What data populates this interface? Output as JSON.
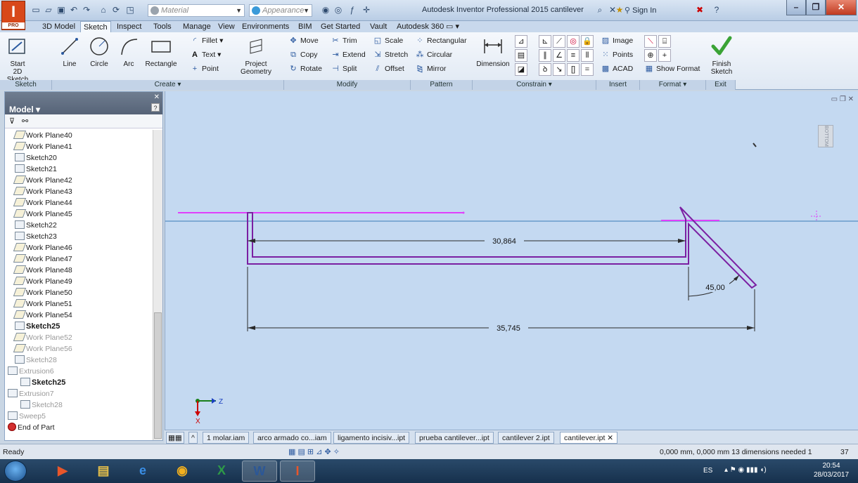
{
  "window": {
    "title": "Autodesk Inventor Professional 2015   cantilever",
    "material_placeholder": "Material",
    "appearance_placeholder": "Appearance",
    "sign_in": "Sign In",
    "app_logo_letter": "I",
    "app_logo_sub": "PRO"
  },
  "ribbon_tabs": [
    "3D Model",
    "Sketch",
    "Inspect",
    "Tools",
    "Manage",
    "View",
    "Environments",
    "BIM",
    "Get Started",
    "Vault",
    "Autodesk 360"
  ],
  "active_tab": "Sketch",
  "ribbon": {
    "sketch_panel": {
      "title": "Sketch",
      "start_2d_sketch": "Start\n2D Sketch"
    },
    "create_panel": {
      "title": "Create ▾",
      "line": "Line",
      "circle": "Circle",
      "arc": "Arc",
      "rectangle": "Rectangle",
      "fillet": "Fillet ▾",
      "text": "Text ▾",
      "point": "Point",
      "project_geometry": "Project\nGeometry"
    },
    "modify_panel": {
      "title": "Modify",
      "move": "Move",
      "copy": "Copy",
      "rotate": "Rotate",
      "trim": "Trim",
      "extend": "Extend",
      "split": "Split",
      "scale": "Scale",
      "stretch": "Stretch",
      "offset": "Offset"
    },
    "pattern_panel": {
      "title": "Pattern",
      "rectangular": "Rectangular",
      "circular": "Circular",
      "mirror": "Mirror"
    },
    "constrain_panel": {
      "title": "Constrain ▾",
      "dimension": "Dimension"
    },
    "insert_panel": {
      "title": "Insert",
      "image": "Image",
      "points": "Points",
      "acad": "ACAD"
    },
    "format_panel": {
      "title": "Format ▾",
      "show_format": "Show Format"
    },
    "exit_panel": {
      "title": "Exit",
      "finish_sketch": "Finish\nSketch"
    }
  },
  "browser": {
    "title": "Model ▾",
    "items": [
      {
        "label": "Work Plane40",
        "kind": "plane",
        "style": "normal"
      },
      {
        "label": "Work Plane41",
        "kind": "plane",
        "style": "normal"
      },
      {
        "label": "Sketch20",
        "kind": "sketch",
        "style": "normal"
      },
      {
        "label": "Sketch21",
        "kind": "sketch",
        "style": "normal"
      },
      {
        "label": "Work Plane42",
        "kind": "plane",
        "style": "normal"
      },
      {
        "label": "Work Plane43",
        "kind": "plane",
        "style": "normal"
      },
      {
        "label": "Work Plane44",
        "kind": "plane",
        "style": "normal"
      },
      {
        "label": "Work Plane45",
        "kind": "plane",
        "style": "normal"
      },
      {
        "label": "Sketch22",
        "kind": "sketch",
        "style": "normal"
      },
      {
        "label": "Sketch23",
        "kind": "sketch",
        "style": "normal"
      },
      {
        "label": "Work Plane46",
        "kind": "plane",
        "style": "normal"
      },
      {
        "label": "Work Plane47",
        "kind": "plane",
        "style": "normal"
      },
      {
        "label": "Work Plane48",
        "kind": "plane",
        "style": "normal"
      },
      {
        "label": "Work Plane49",
        "kind": "plane",
        "style": "normal"
      },
      {
        "label": "Work Plane50",
        "kind": "plane",
        "style": "normal"
      },
      {
        "label": "Work Plane51",
        "kind": "plane",
        "style": "normal"
      },
      {
        "label": "Work Plane54",
        "kind": "plane",
        "style": "normal"
      },
      {
        "label": "Sketch25",
        "kind": "sketch",
        "style": "bold"
      },
      {
        "label": "Work Plane52",
        "kind": "plane",
        "style": "dim"
      },
      {
        "label": "Work Plane56",
        "kind": "plane",
        "style": "dim"
      },
      {
        "label": "Sketch28",
        "kind": "sketch",
        "style": "dim"
      },
      {
        "label": "Extrusion6",
        "kind": "feature",
        "style": "dim"
      },
      {
        "label": "Sketch25",
        "kind": "sketch",
        "style": "bold"
      },
      {
        "label": "Extrusion7",
        "kind": "feature",
        "style": "dim"
      },
      {
        "label": "Sketch28",
        "kind": "sketch",
        "style": "dim"
      },
      {
        "label": "Sweep5",
        "kind": "feature",
        "style": "dim"
      },
      {
        "label": "End of Part",
        "kind": "end",
        "style": "normal"
      }
    ]
  },
  "viewport": {
    "view_cube_label": "BOTTOM",
    "dimensions": {
      "inner_length": "30,864",
      "total_length": "35,745",
      "angle": "45,00"
    },
    "axis_labels": {
      "z": "Z",
      "x": "X"
    },
    "colors": {
      "geometry": "#7b1fa2",
      "projected": "#e040fb",
      "dimension": "#2a2a2a",
      "axis_line": "#3a7ab8"
    }
  },
  "doc_tabs": [
    "1 molar.iam",
    "arco armado co...iam",
    "ligamento incisiv...ipt",
    "prueba cantilever...ipt",
    "cantilever 2.ipt",
    "cantilever.ipt"
  ],
  "active_doc": "cantilever.ipt",
  "status": {
    "text": "Ready",
    "coords": "0,000 mm, 0,000 mm  13 dimensions needed  1",
    "page": "37"
  },
  "taskbar": {
    "lang": "ES",
    "time": "20:54",
    "date": "28/03/2017"
  }
}
